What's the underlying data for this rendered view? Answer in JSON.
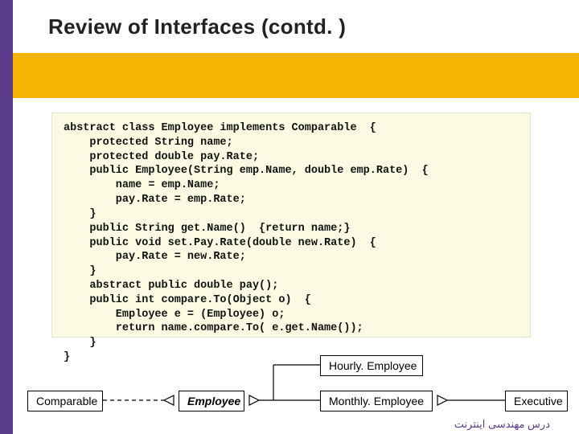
{
  "title": "Review of Interfaces (contd. )",
  "code": "abstract class Employee implements Comparable  {\n    protected String name;\n    protected double pay.Rate;\n    public Employee(String emp.Name, double emp.Rate)  {\n        name = emp.Name;\n        pay.Rate = emp.Rate;\n    }\n    public String get.Name()  {return name;}\n    public void set.Pay.Rate(double new.Rate)  {\n        pay.Rate = new.Rate;\n    }\n    abstract public double pay();\n    public int compare.To(Object o)  {\n        Employee e = (Employee) o;\n        return name.compare.To( e.get.Name());\n    }\n}",
  "uml": {
    "comparable": "Comparable",
    "employee": "Employee",
    "hourly": "Hourly. Employee",
    "monthly": "Monthly. Employee",
    "executive": "Executive"
  },
  "footer": "درس مهندسی اینترنت"
}
